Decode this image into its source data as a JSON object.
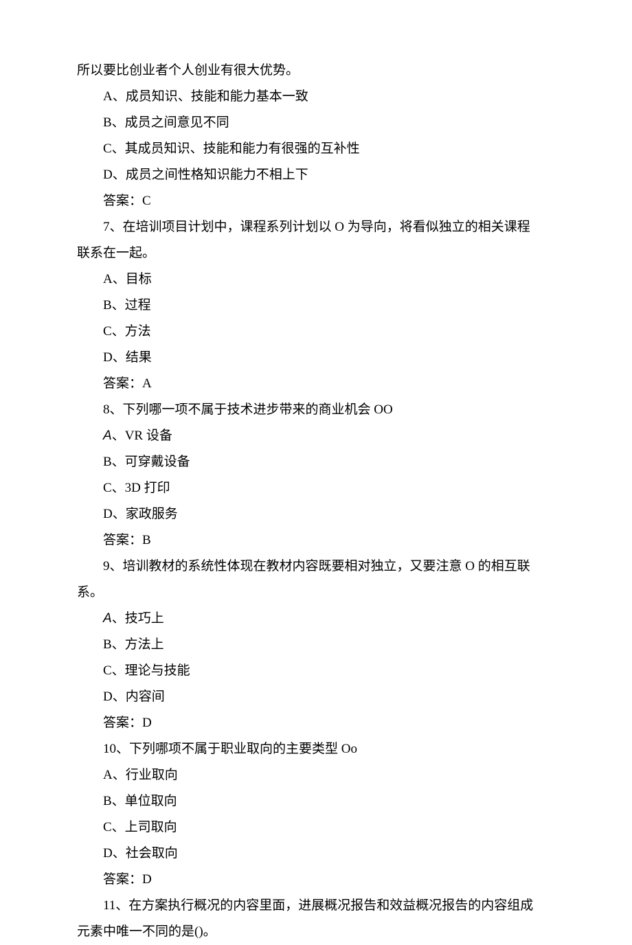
{
  "lines": [
    {
      "cls": "out",
      "text": "所以要比创业者个人创业有很大优势。"
    },
    {
      "cls": "indent-2",
      "text": "A、成员知识、技能和能力基本一致"
    },
    {
      "cls": "indent-2",
      "text": "B、成员之间意见不同"
    },
    {
      "cls": "indent-2",
      "text": "C、其成员知识、技能和能力有很强的互补性"
    },
    {
      "cls": "indent-2",
      "text": "D、成员之间性格知识能力不相上下"
    },
    {
      "cls": "indent-2",
      "text": "答案：C"
    },
    {
      "cls": "indent-2",
      "text": "7、在培训项目计划中，课程系列计划以 O 为导向，将看似独立的相关课程"
    },
    {
      "cls": "out",
      "text": "联系在一起。"
    },
    {
      "cls": "indent-2",
      "text": "A、目标"
    },
    {
      "cls": "indent-2",
      "text": "B、过程"
    },
    {
      "cls": "indent-2",
      "text": "C、方法"
    },
    {
      "cls": "indent-2",
      "text": "D、结果"
    },
    {
      "cls": "indent-2",
      "text": "答案：A"
    },
    {
      "cls": "indent-2",
      "text": "8、下列哪一项不属于技术进步带来的商业机会 OO"
    },
    {
      "cls": "indent-2",
      "parts": [
        {
          "text": "A",
          "italicA": true
        },
        {
          "text": "、VR 设备"
        }
      ]
    },
    {
      "cls": "indent-2",
      "text": "B、可穿戴设备"
    },
    {
      "cls": "indent-2",
      "text": "C、3D 打印"
    },
    {
      "cls": "indent-2",
      "text": "D、家政服务"
    },
    {
      "cls": "indent-2",
      "text": "答案：B"
    },
    {
      "cls": "indent-2",
      "text": "9、培训教材的系统性体现在教材内容既要相对独立，又要注意 O 的相互联"
    },
    {
      "cls": "out",
      "text": "系。"
    },
    {
      "cls": "indent-2",
      "parts": [
        {
          "text": "A",
          "italicA": true
        },
        {
          "text": "、技巧上"
        }
      ]
    },
    {
      "cls": "indent-2",
      "text": "B、方法上"
    },
    {
      "cls": "indent-2",
      "text": "C、理论与技能"
    },
    {
      "cls": "indent-2",
      "text": "D、内容间"
    },
    {
      "cls": "indent-2",
      "text": "答案：D"
    },
    {
      "cls": "indent-2",
      "text": "10、下列哪项不属于职业取向的主要类型 Oo"
    },
    {
      "cls": "indent-2",
      "text": "A、行业取向"
    },
    {
      "cls": "indent-2",
      "text": "B、单位取向"
    },
    {
      "cls": "indent-2",
      "text": "C、上司取向"
    },
    {
      "cls": "indent-2",
      "text": "D、社会取向"
    },
    {
      "cls": "indent-2",
      "text": "答案：D"
    },
    {
      "cls": "indent-2",
      "text": "11、在方案执行概况的内容里面，进展概况报告和效益概况报告的内容组成"
    },
    {
      "cls": "out",
      "text": "元素中唯一不同的是()。"
    }
  ]
}
